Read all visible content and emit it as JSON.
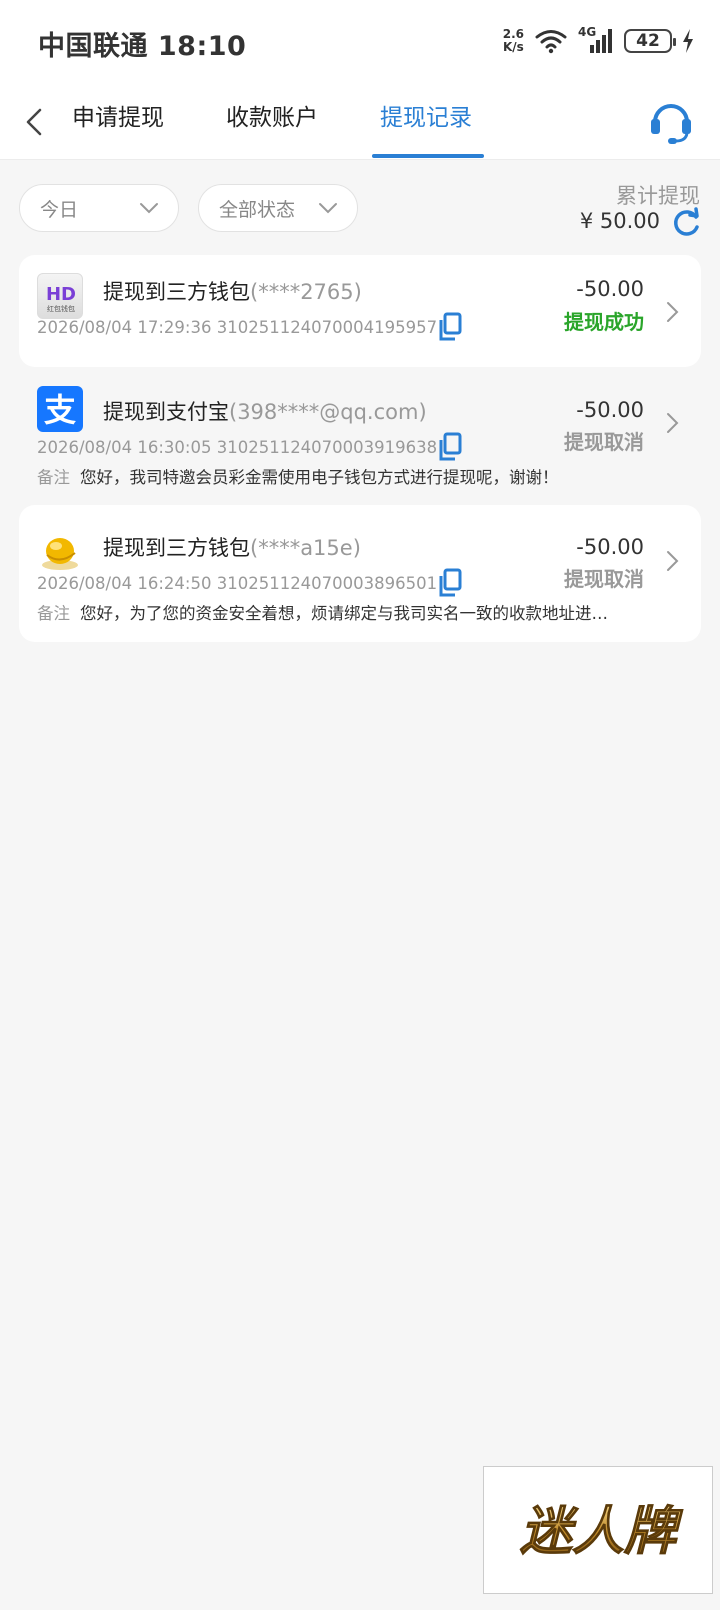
{
  "status_bar": {
    "carrier_time": "中国联通 18:10",
    "net_speed_value": "2.6",
    "net_speed_unit": "K/s",
    "network": "4G",
    "battery": "42"
  },
  "nav": {
    "tabs": [
      {
        "label": "申请提现"
      },
      {
        "label": "收款账户"
      },
      {
        "label": "提现记录",
        "active": true
      }
    ],
    "accent_color": "#2a7fd4"
  },
  "filters": {
    "date": "今日",
    "status": "全部状态"
  },
  "summary": {
    "label": "累计提现",
    "amount": "¥ 50.00"
  },
  "records": [
    {
      "title": "提现到三方钱包",
      "account": "(****2765)",
      "datetime": "2026/08/04 17:29:36",
      "order_no": "310251124070004195957",
      "amount": "-50.00",
      "status": "提现成功",
      "logo_text": "红包钱包",
      "logo_icon": "hd-wallet-logo"
    },
    {
      "title": "提现到支付宝",
      "account": "(398****@qq.com)",
      "datetime": "2026/08/04 16:30:05",
      "order_no": "310251124070003919638",
      "amount": "-50.00",
      "status": "提现取消",
      "remark_label": "备注",
      "remark": "您好，我司特邀会员彩金需使用电子钱包方式进行提现呢，谢谢！",
      "logo_icon": "alipay-logo"
    },
    {
      "title": "提现到三方钱包",
      "account": "(****a15e)",
      "datetime": "2026/08/04 16:24:50",
      "order_no": "310251124070003896501",
      "amount": "-50.00",
      "status": "提现取消",
      "remark_label": "备注",
      "remark": "您好，为了您的资金安全着想，烦请绑定与我司实名一致的收款地址进…",
      "logo_icon": "gold-coin-logo"
    }
  ],
  "watermark": {
    "text": "迷人牌"
  }
}
